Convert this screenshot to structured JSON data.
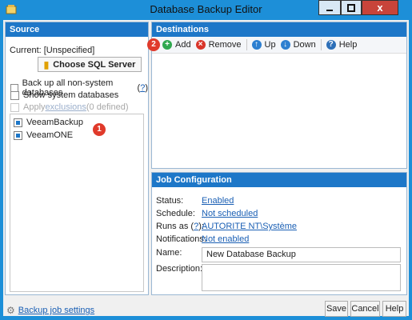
{
  "window": {
    "title": "Database Backup Editor",
    "close_glyph": "x"
  },
  "source": {
    "header": "Source",
    "current_label": "Current:",
    "current_value": "[Unspecified]",
    "choose_button": "Choose SQL Server",
    "backup_all": {
      "text": "Back up all non-system databases",
      "paren_open": "(",
      "link": "?",
      "paren_close": ")"
    },
    "show_system": "Show system databases",
    "apply_exclusions": {
      "prefix": "Apply ",
      "link": "exclusions",
      "suffix": " (0 defined)"
    },
    "databases": [
      "VeeamBackup",
      "VeeamONE"
    ],
    "badge": "1"
  },
  "destinations": {
    "header": "Destinations",
    "badge": "2",
    "toolbar": {
      "add": "Add",
      "remove": "Remove",
      "up": "Up",
      "down": "Down",
      "help": "Help"
    }
  },
  "job": {
    "header": "Job Configuration",
    "status_label": "Status:",
    "status_value": "Enabled",
    "schedule_label": "Schedule:",
    "schedule_value": "Not scheduled",
    "runas_label_prefix": "Runs as (",
    "runas_label_link": "?",
    "runas_label_suffix": "):",
    "runas_value": "AUTORITE NT\\Système",
    "notifications_label": "Notifications:",
    "notifications_value": "Not enabled",
    "name_label": "Name:",
    "name_value": "New Database Backup",
    "description_label": "Description:",
    "description_value": ""
  },
  "footer": {
    "settings_link": "Backup job settings",
    "save": "Save",
    "cancel": "Cancel",
    "help": "Help"
  },
  "colors": {
    "accent": "#1d8fd8",
    "header": "#1d77c8",
    "link": "#1a5fb4",
    "badge": "#e03a2b"
  }
}
